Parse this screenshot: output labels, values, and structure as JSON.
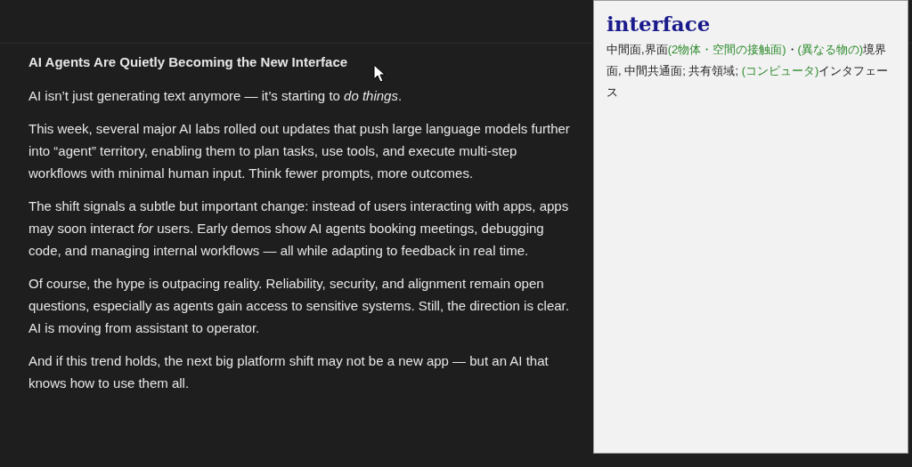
{
  "article": {
    "title": "AI Agents Are Quietly Becoming the New Interface",
    "paragraphs": [
      "AI isn’t just generating text anymore — it’s starting to *do things*.",
      "This week, several major AI labs rolled out updates that push large language models further into “agent” territory, enabling them to plan tasks, use tools, and execute multi-step workflows with minimal human input. Think fewer prompts, more outcomes.",
      "The shift signals a subtle but important change: instead of users interacting with apps, apps may soon interact *for* users. Early demos show AI agents booking meetings, debugging code, and managing internal workflows — all while adapting to feedback in real time.",
      "Of course, the hype is outpacing reality. Reliability, security, and alignment remain open questions, especially as agents gain access to sensitive systems. Still, the direction is clear. AI is moving from assistant to operator.",
      "And if this trend holds, the next big platform shift may not be a new app — but an AI that knows how to use them all."
    ]
  },
  "dictionary": {
    "headword": "interface",
    "definition": [
      {
        "kind": "text",
        "text": "中間面,界面"
      },
      {
        "kind": "note",
        "text": "(2物体・空間の接触面)"
      },
      {
        "kind": "text",
        "text": "・"
      },
      {
        "kind": "note",
        "text": "(異なる物の)"
      },
      {
        "kind": "text",
        "text": "境界面, 中間共通面; 共有領域; "
      },
      {
        "kind": "note",
        "text": "(コンピュータ)"
      },
      {
        "kind": "text",
        "text": "インタフェース"
      }
    ]
  }
}
